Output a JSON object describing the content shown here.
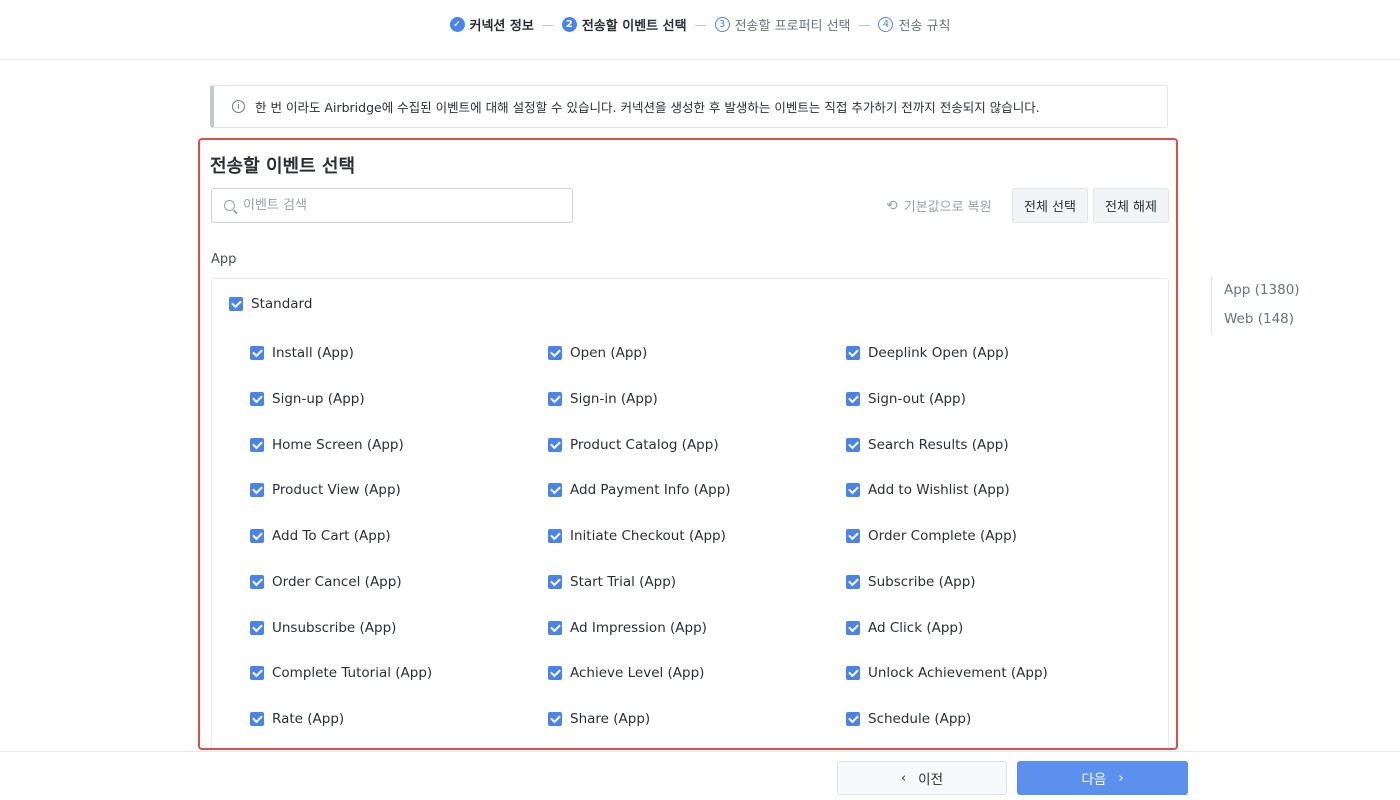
{
  "stepper": {
    "steps": [
      {
        "num": "✓",
        "label": "커넥션 정보",
        "state": "done"
      },
      {
        "num": "2",
        "label": "전송할 이벤트 선택",
        "state": "active"
      },
      {
        "num": "3",
        "label": "전송할 프로퍼티 선택",
        "state": "pending"
      },
      {
        "num": "4",
        "label": "전송 규칙",
        "state": "pending"
      }
    ],
    "separator": "—"
  },
  "info": {
    "icon": "i",
    "text": "한 번 이라도 Airbridge에 수집된 이벤트에 대해 설정할 수 있습니다. 커넥션을 생성한 후 발생하는 이벤트는 직접 추가하기 전까지 전송되지 않습니다."
  },
  "panel": {
    "title": "전송할 이벤트 선택",
    "search_placeholder": "이벤트 검색",
    "reset_label": "기본값으로 복원",
    "select_all_label": "전체 선택",
    "deselect_all_label": "전체 해제",
    "group_label": "App",
    "category_label": "Standard",
    "events": [
      "Install (App)",
      "Open (App)",
      "Deeplink Open (App)",
      "Sign-up (App)",
      "Sign-in (App)",
      "Sign-out (App)",
      "Home Screen (App)",
      "Product Catalog (App)",
      "Search Results (App)",
      "Product View (App)",
      "Add Payment Info (App)",
      "Add to Wishlist (App)",
      "Add To Cart (App)",
      "Initiate Checkout (App)",
      "Order Complete (App)",
      "Order Cancel (App)",
      "Start Trial (App)",
      "Subscribe (App)",
      "Unsubscribe (App)",
      "Ad Impression (App)",
      "Ad Click (App)",
      "Complete Tutorial (App)",
      "Achieve Level (App)",
      "Unlock Achievement (App)",
      "Rate (App)",
      "Share (App)",
      "Schedule (App)"
    ]
  },
  "anchors": [
    "App (1380)",
    "Web (148)"
  ],
  "footer": {
    "prev_label": "이전",
    "next_label": "다음",
    "prev_chevron": "‹",
    "next_chevron": "›"
  },
  "colors": {
    "accent": "#4a84e8",
    "highlight_border": "#e04b4b",
    "next_button": "#5b90ee"
  }
}
